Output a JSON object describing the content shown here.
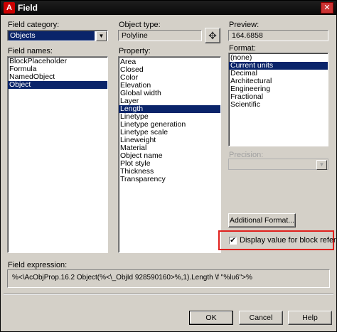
{
  "window": {
    "title": "Field",
    "app_icon": "autocad-icon",
    "close_glyph": "✕"
  },
  "field_category": {
    "label": "Field category:",
    "selected": "Objects"
  },
  "field_names": {
    "label": "Field names:",
    "items": [
      "BlockPlaceholder",
      "Formula",
      "NamedObject",
      "Object"
    ],
    "selected_index": 3
  },
  "object_type": {
    "label": "Object type:",
    "value": "Polyline",
    "select_object_icon": "crosshair-pick-icon"
  },
  "property": {
    "label": "Property:",
    "items": [
      "Area",
      "Closed",
      "Color",
      "Elevation",
      "Global width",
      "Layer",
      "Length",
      "Linetype",
      "Linetype generation",
      "Linetype scale",
      "Lineweight",
      "Material",
      "Object name",
      "Plot style",
      "Thickness",
      "Transparency"
    ],
    "selected_index": 6
  },
  "preview": {
    "label": "Preview:",
    "value": "164.6858"
  },
  "format": {
    "label": "Format:",
    "items": [
      "(none)",
      "Current units",
      "Decimal",
      "Architectural",
      "Engineering",
      "Fractional",
      "Scientific"
    ],
    "selected_index": 1
  },
  "precision": {
    "label": "Precision:",
    "value": "",
    "enabled": false
  },
  "additional_format_button": "Additional Format...",
  "display_block_reference": {
    "label": "Display value for block reference",
    "checked": true,
    "check_glyph": "✔",
    "highlight_color": "#e0201c"
  },
  "field_expression": {
    "label": "Field expression:",
    "value": "%<\\AcObjProp.16.2 Object(%<\\_ObjId 928590160>%,1).Length \\f \"%lu6\">%"
  },
  "buttons": {
    "ok": "OK",
    "cancel": "Cancel",
    "help": "Help"
  },
  "colors": {
    "selection": "#0a246a",
    "dialog_bg": "#d4d0c8"
  }
}
